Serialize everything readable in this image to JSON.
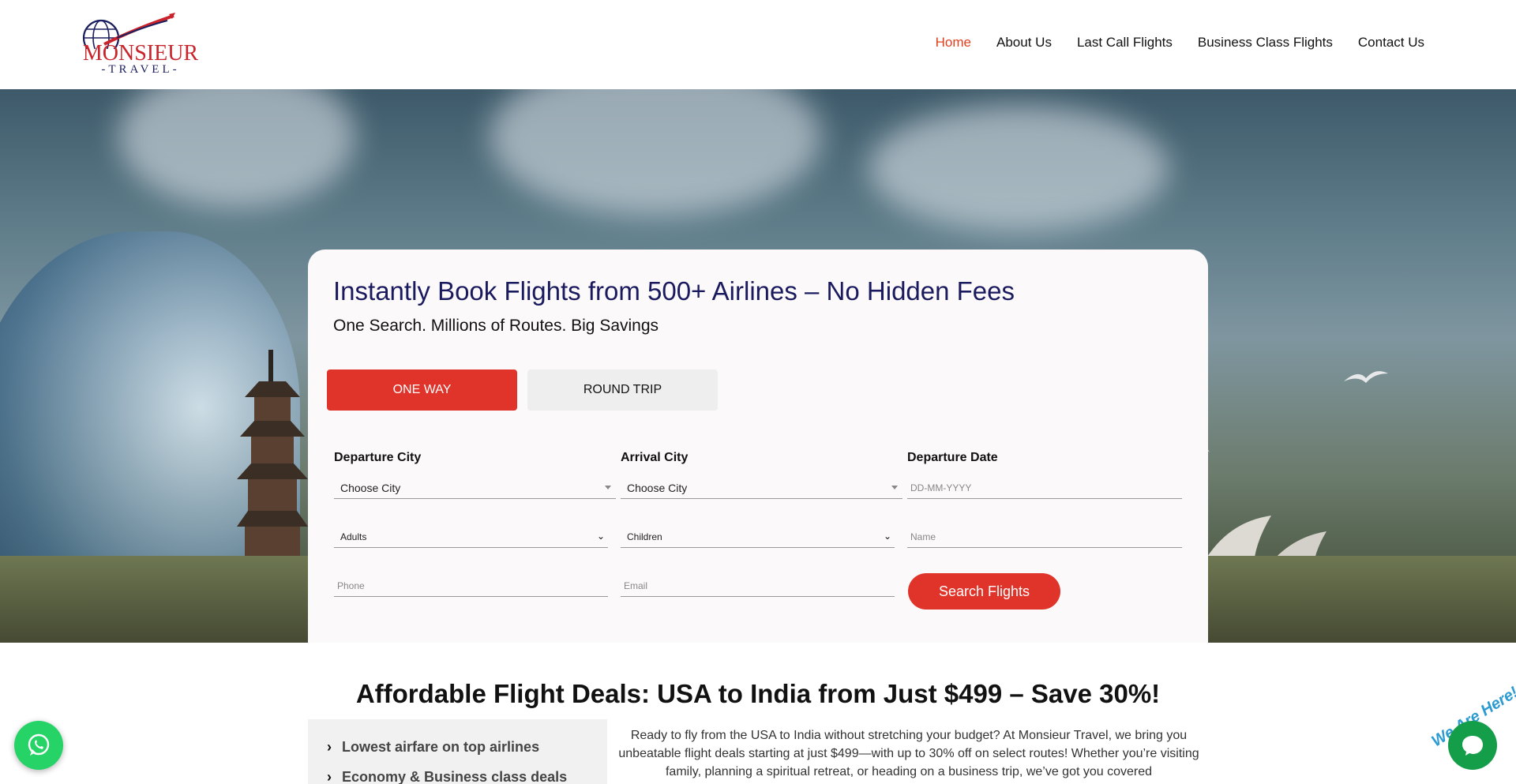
{
  "header": {
    "logo_brand": "MONSIEUR",
    "logo_sub": "-TRAVEL-",
    "nav": [
      {
        "label": "Home",
        "active": true
      },
      {
        "label": "About Us"
      },
      {
        "label": "Last Call Flights"
      },
      {
        "label": "Business Class Flights"
      },
      {
        "label": "Contact Us"
      }
    ]
  },
  "hero": {
    "title": "Instantly Book Flights from 500+ Airlines – No Hidden Fees",
    "subtitle": "One Search. Millions of Routes. Big Savings",
    "trip_types": [
      "ONE WAY",
      "ROUND TRIP"
    ],
    "active_trip_type": "ONE WAY",
    "form": {
      "departure_label": "Departure City",
      "departure_value": "Choose City",
      "arrival_label": "Arrival City",
      "arrival_value": "Choose City",
      "date_label": "Departure Date",
      "date_placeholder": "DD-MM-YYYY",
      "adults_value": "Adults",
      "children_value": "Children",
      "name_placeholder": "Name",
      "phone_placeholder": "Phone",
      "email_placeholder": "Email",
      "search_label": "Search Flights"
    }
  },
  "deals": {
    "title": "Affordable Flight Deals: USA to India from Just $499 – Save 30%!",
    "list": [
      "Lowest airfare on top airlines",
      "Economy & Business class deals"
    ],
    "text": "Ready to fly from the USA to India without stretching your budget? At Monsieur Travel, we bring you unbeatable flight deals starting at just $499—with up to 30% off on select routes! Whether you’re visiting family, planning a spiritual retreat, or heading on a business trip, we’ve got you covered"
  },
  "widgets": {
    "chat_tag": "We Are Here!"
  },
  "colors": {
    "accent_red": "#e0332a",
    "nav_active": "#e0401f",
    "title_navy": "#1a1a5e",
    "whatsapp_green": "#25d366",
    "chat_green": "#159e4a"
  }
}
